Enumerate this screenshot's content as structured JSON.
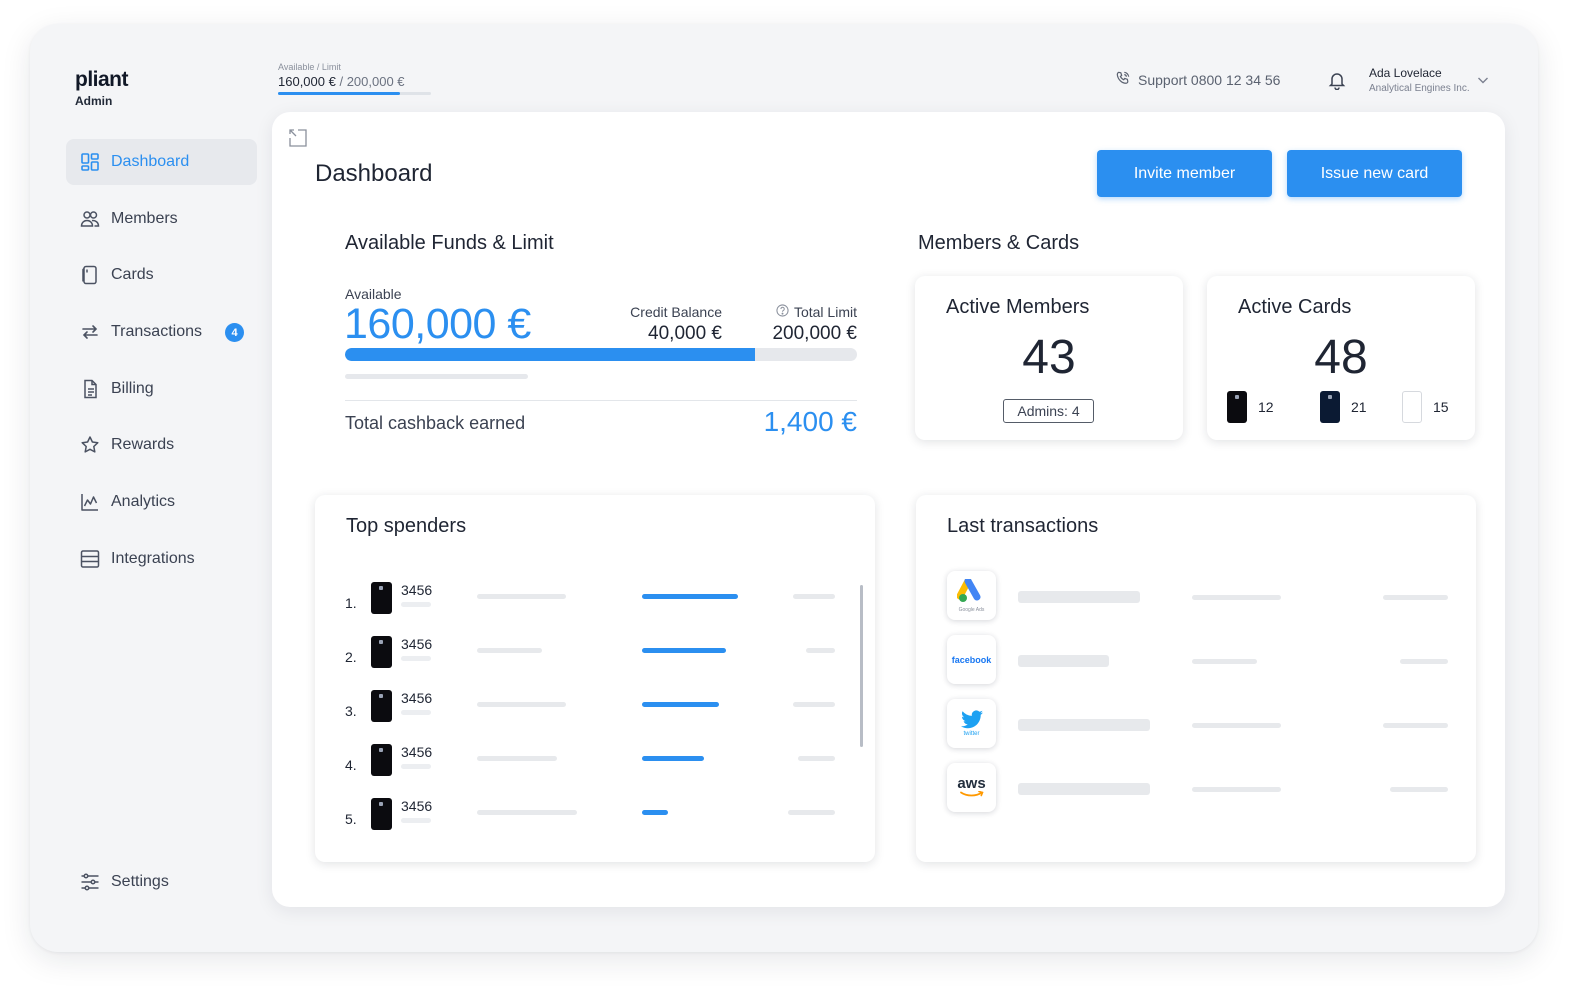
{
  "brand": {
    "name": "pliant",
    "role": "Admin"
  },
  "topbar": {
    "limit_caption": "Available / Limit",
    "available": "160,000 €",
    "separator": " / ",
    "limit": "200,000 €",
    "available_fraction": 0.8,
    "support": "Support 0800 12 34 56",
    "user_name": "Ada Lovelace",
    "user_company": "Analytical Engines Inc."
  },
  "sidebar": {
    "items": [
      {
        "label": "Dashboard",
        "icon": "dashboard-icon",
        "active": true
      },
      {
        "label": "Members",
        "icon": "members-icon"
      },
      {
        "label": "Cards",
        "icon": "cards-icon"
      },
      {
        "label": "Transactions",
        "icon": "transactions-icon",
        "badge": "4"
      },
      {
        "label": "Billing",
        "icon": "billing-icon"
      },
      {
        "label": "Rewards",
        "icon": "star-icon"
      },
      {
        "label": "Analytics",
        "icon": "analytics-icon"
      },
      {
        "label": "Integrations",
        "icon": "integrations-icon"
      }
    ],
    "settings": {
      "label": "Settings",
      "icon": "sliders-icon"
    }
  },
  "main": {
    "title": "Dashboard",
    "invite_label": "Invite member",
    "issue_label": "Issue new card"
  },
  "funds": {
    "title": "Available Funds & Limit",
    "available_label": "Available",
    "available_value": "160,000 €",
    "credit_label": "Credit Balance",
    "credit_value": "40,000 €",
    "limit_label": "Total Limit",
    "limit_value": "200,000 €",
    "available_fraction": 0.8,
    "cashback_label": "Total cashback earned",
    "cashback_value": "1,400 €"
  },
  "members_cards": {
    "title": "Members & Cards",
    "members": {
      "title": "Active Members",
      "count": "43",
      "admins": "Admins: 4"
    },
    "cards": {
      "title": "Active Cards",
      "count": "48",
      "types": [
        {
          "style": "black",
          "count": "12"
        },
        {
          "style": "navy",
          "count": "21"
        },
        {
          "style": "white",
          "count": "15"
        }
      ]
    }
  },
  "top_spenders": {
    "title": "Top spenders",
    "rows": [
      {
        "rank": "1.",
        "card": "3456",
        "share": 1.0
      },
      {
        "rank": "2.",
        "card": "3456",
        "share": 0.88
      },
      {
        "rank": "3.",
        "card": "3456",
        "share": 0.8
      },
      {
        "rank": "4.",
        "card": "3456",
        "share": 0.65
      },
      {
        "rank": "5.",
        "card": "3456",
        "share": 0.27
      }
    ]
  },
  "last_transactions": {
    "title": "Last transactions",
    "merchants": [
      {
        "name": "google-ads",
        "icon": "google-ads-logo",
        "label": "Google Ads"
      },
      {
        "name": "facebook",
        "icon": "facebook-logo",
        "label": "facebook"
      },
      {
        "name": "twitter",
        "icon": "twitter-logo",
        "label": "twitter"
      },
      {
        "name": "aws",
        "icon": "aws-logo",
        "label": "aws"
      }
    ]
  },
  "colors": {
    "accent": "#2b8ff0",
    "text": "#1f2533",
    "muted": "#3b4252",
    "skeleton": "#e7e9ec"
  }
}
